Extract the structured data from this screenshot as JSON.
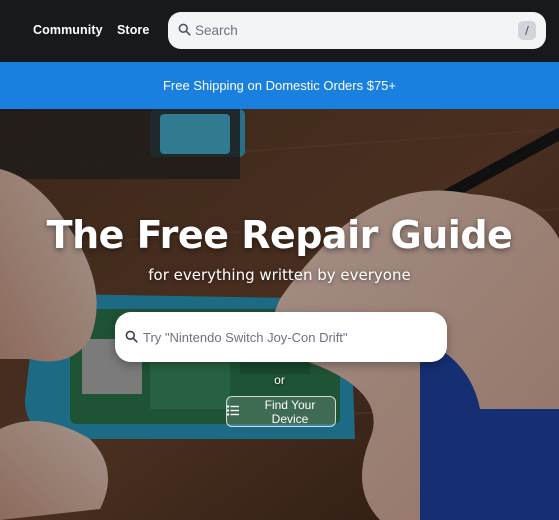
{
  "nav": {
    "links": [
      "Community",
      "Store"
    ],
    "search": {
      "placeholder": "Search",
      "shortcut": "/"
    }
  },
  "promo": {
    "text": "Free Shipping on Domestic Orders $75+"
  },
  "hero": {
    "title": "The Free Repair Guide",
    "subtitle": "for everything written by everyone",
    "search_placeholder": "Try \"Nintendo Switch Joy-Con Drift\"",
    "or_text": "or",
    "find_device_label": "Find Your Device"
  },
  "colors": {
    "topbar": "#17191c",
    "promo": "#1a80e0",
    "search_bg": "#f3f4f6"
  },
  "icons": [
    "search-icon",
    "list-icon"
  ]
}
